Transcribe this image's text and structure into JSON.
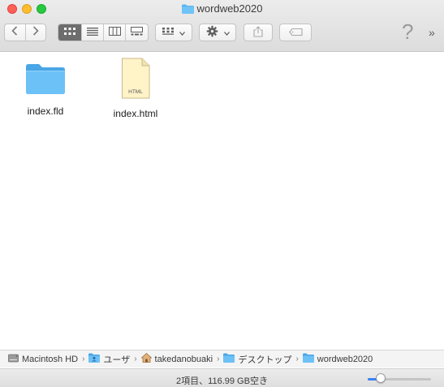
{
  "window": {
    "title": "wordweb2020"
  },
  "toolbar": {
    "back_icon": "chevron-left-icon",
    "forward_icon": "chevron-right-icon",
    "view_modes": [
      "icon-view-icon",
      "list-view-icon",
      "column-view-icon",
      "gallery-view-icon"
    ],
    "active_view": 0,
    "group_icon": "grid-icon",
    "action_icon": "gear-icon",
    "share_icon": "share-icon",
    "tag_icon": "tag-icon",
    "help_label": "?",
    "more_label": "»"
  },
  "files": [
    {
      "name": "index.fld",
      "kind": "folder"
    },
    {
      "name": "index.html",
      "kind": "html",
      "badge": "HTML"
    }
  ],
  "pathbar": {
    "items": [
      {
        "label": "Macintosh HD",
        "icon": "drive-icon"
      },
      {
        "label": "ユーザ",
        "icon": "users-folder-icon"
      },
      {
        "label": "takedanobuaki",
        "icon": "home-icon"
      },
      {
        "label": "デスクトップ",
        "icon": "folder-icon"
      },
      {
        "label": "wordweb2020",
        "icon": "folder-icon"
      }
    ],
    "separator": "›"
  },
  "status": {
    "text": "2項目、116.99 GB空き",
    "zoom": 0.2
  },
  "colors": {
    "folder": "#5ab4f0",
    "accent": "#3b82f6",
    "close": "#fe5f57",
    "minimize": "#febc2e",
    "maximize": "#28c840"
  }
}
